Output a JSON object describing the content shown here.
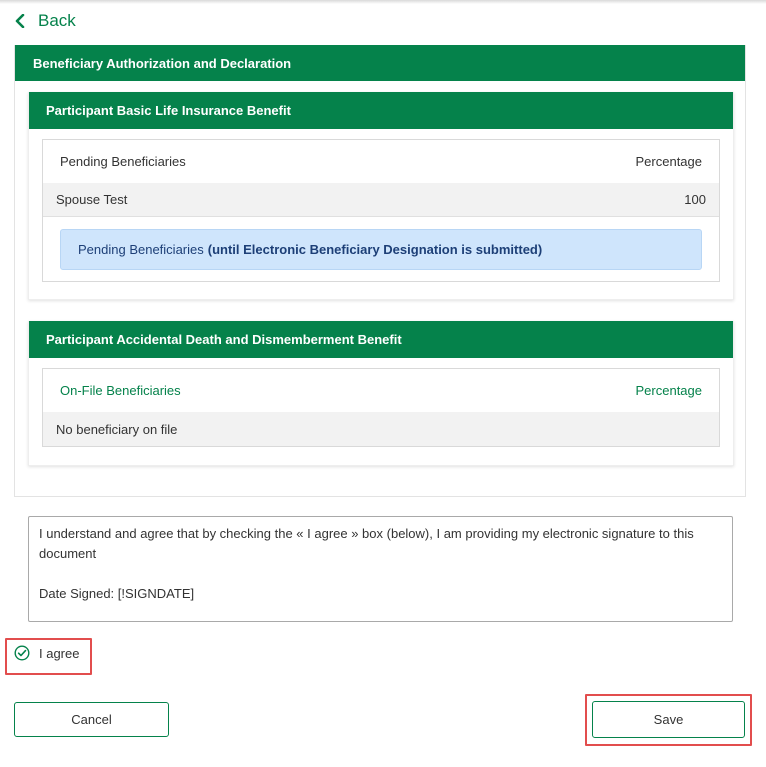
{
  "nav": {
    "back_label": "Back"
  },
  "card": {
    "title": "Beneficiary Authorization and Declaration",
    "sections": [
      {
        "title": "Participant Basic Life Insurance Benefit",
        "table_header": {
          "name": "Pending Beneficiaries",
          "percent": "Percentage"
        },
        "rows": [
          {
            "name": "Spouse Test",
            "percent": "100"
          }
        ],
        "note_prefix": "Pending Beneficiaries",
        "note_bold": "(until Electronic Beneficiary Designation is submitted)"
      },
      {
        "title": "Participant Accidental Death and Dismemberment Benefit",
        "table_header": {
          "name": "On-File Beneficiaries",
          "percent": "Percentage"
        },
        "rows": [
          {
            "name": "No beneficiary on file"
          }
        ]
      }
    ]
  },
  "agreement": {
    "line1": "I understand and agree that by checking the « I agree » box (below), I am providing my electronic signature to this document",
    "line2": "Date Signed: [!SIGNDATE]"
  },
  "checkbox": {
    "label": "I agree",
    "checked": true
  },
  "buttons": {
    "cancel": "Cancel",
    "save": "Save"
  },
  "colors": {
    "brand_green": "#05824b",
    "info_blue": "#cfe5fc",
    "highlight_red": "#e24d4d"
  }
}
